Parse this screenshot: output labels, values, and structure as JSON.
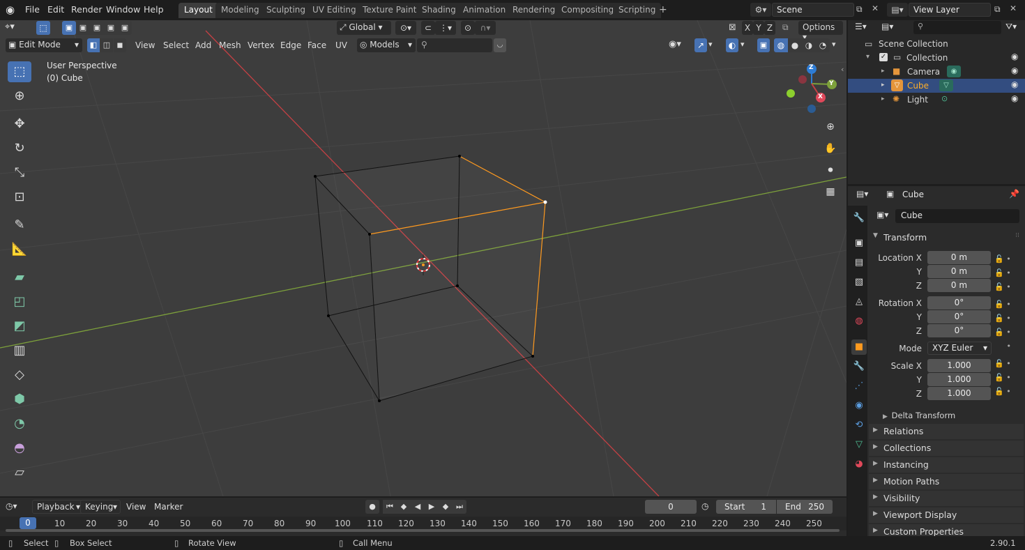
{
  "menubar": {
    "items": [
      "File",
      "Edit",
      "Render",
      "Window",
      "Help"
    ],
    "workspaces": [
      "Layout",
      "Modeling",
      "Sculpting",
      "UV Editing",
      "Texture Paint",
      "Shading",
      "Animation",
      "Rendering",
      "Compositing",
      "Scripting"
    ],
    "active_workspace": "Layout",
    "add_workspace": "+",
    "scene": "Scene",
    "view_layer": "View Layer"
  },
  "viewport_header": {
    "transform_orientation": "Global",
    "options": "Options",
    "mode": "Edit Mode",
    "menus": [
      "View",
      "Select",
      "Add",
      "Mesh",
      "Vertex",
      "Edge",
      "Face",
      "UV"
    ],
    "snap_target": "Models",
    "axes": [
      "X",
      "Y",
      "Z"
    ]
  },
  "viewport": {
    "perspective_label": "User Perspective",
    "object_label": "(0) Cube",
    "gizmo_axes": [
      "Z",
      "Y",
      "X"
    ]
  },
  "outliner": {
    "root": "Scene Collection",
    "collection": "Collection",
    "objects": [
      "Camera",
      "Cube",
      "Light"
    ],
    "selected": "Cube"
  },
  "properties": {
    "header_object": "Cube",
    "object_name": "Cube",
    "transform_title": "Transform",
    "location_label": "Location X",
    "rotation_label": "Rotation X",
    "scale_label": "Scale X",
    "axis_y": "Y",
    "axis_z": "Z",
    "location": [
      "0 m",
      "0 m",
      "0 m"
    ],
    "rotation": [
      "0°",
      "0°",
      "0°"
    ],
    "mode_label": "Mode",
    "mode_value": "XYZ Euler",
    "scale": [
      "1.000",
      "1.000",
      "1.000"
    ],
    "delta": "Delta Transform",
    "panels": [
      "Relations",
      "Collections",
      "Instancing",
      "Motion Paths",
      "Visibility",
      "Viewport Display",
      "Custom Properties"
    ]
  },
  "timeline": {
    "menus": [
      "Playback",
      "Keying",
      "View",
      "Marker"
    ],
    "current_frame": "0",
    "start_label": "Start",
    "start": "1",
    "end_label": "End",
    "end": "250",
    "ticks": [
      "0",
      "10",
      "20",
      "30",
      "40",
      "50",
      "60",
      "70",
      "80",
      "90",
      "100",
      "110",
      "120",
      "130",
      "140",
      "150",
      "160",
      "170",
      "180",
      "190",
      "200",
      "210",
      "220",
      "230",
      "240",
      "250"
    ]
  },
  "statusbar": {
    "select": "Select",
    "box_select": "Box Select",
    "rotate": "Rotate View",
    "call_menu": "Call Menu",
    "version": "2.90.1"
  },
  "colors": {
    "accent": "#4772b3",
    "x_axis": "#c44044",
    "y_axis": "#7da13b",
    "selected_edge": "#ff9a1f",
    "outliner_selected": "#334d80"
  }
}
